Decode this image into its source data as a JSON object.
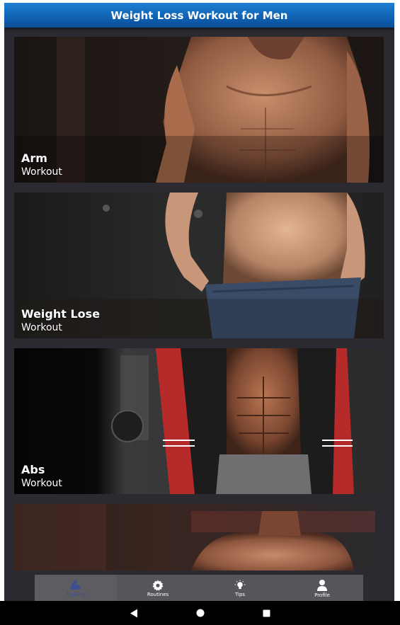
{
  "app": {
    "title": "Weight Loss Workout for Men"
  },
  "cards": [
    {
      "title": "Arm",
      "subtitle": "Workout"
    },
    {
      "title": "Weight Lose",
      "subtitle": "Workout"
    },
    {
      "title": "Abs",
      "subtitle": "Workout"
    },
    {
      "title": "",
      "subtitle": ""
    }
  ],
  "bottom_nav": [
    {
      "label": "Training",
      "icon": "flexed-arm-icon",
      "active": true
    },
    {
      "label": "Routines",
      "icon": "gear-icon",
      "active": false
    },
    {
      "label": "Tips",
      "icon": "lightbulb-icon",
      "active": false
    },
    {
      "label": "Profile",
      "icon": "person-icon",
      "active": false
    }
  ],
  "system_nav": {
    "buttons": [
      "back-icon",
      "home-icon",
      "recents-icon"
    ]
  },
  "colors": {
    "header": "#1466b8",
    "background": "#2b2a30",
    "nav_active": "#3c4f8f"
  }
}
